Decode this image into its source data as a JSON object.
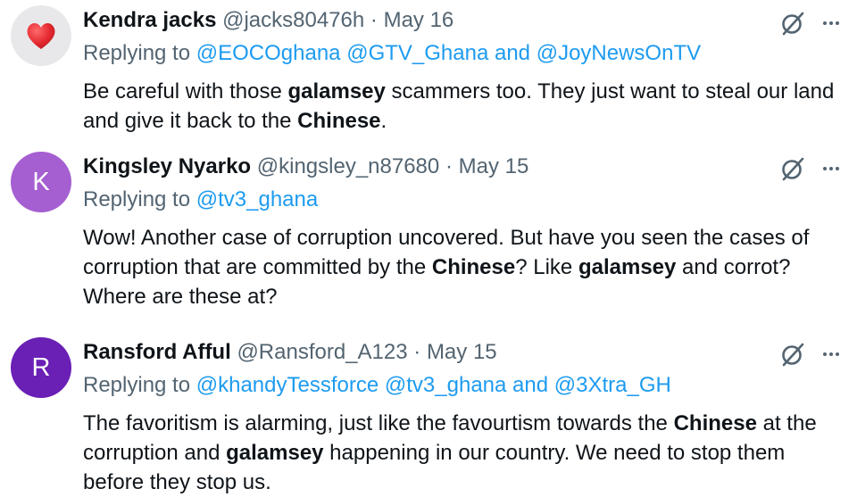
{
  "replies": [
    {
      "avatar": {
        "kind": "heart",
        "icon": "red-heart-icon",
        "color": "#e3282f",
        "bg": "#e8e8ea"
      },
      "name": "Kendra jacks",
      "handle": "@jacks80476h",
      "sep": "·",
      "date": "May 16",
      "replying_to": {
        "label": "Replying to",
        "handles": [
          "@EOCOghana",
          "@GTV_Ghana"
        ],
        "and": "and",
        "last": "@JoyNewsOnTV"
      },
      "text": [
        {
          "t": "Be careful with those "
        },
        {
          "t": "galamsey",
          "b": true
        },
        {
          "t": " scammers too. They just want to steal our land and give it back to the "
        },
        {
          "t": "Chinese",
          "b": true
        },
        {
          "t": "."
        }
      ]
    },
    {
      "avatar": {
        "kind": "letter",
        "letter": "K",
        "bg": "#a55fd1"
      },
      "name": "Kingsley Nyarko",
      "handle": "@kingsley_n87680",
      "sep": "·",
      "date": "May 15",
      "replying_to": {
        "label": "Replying to",
        "handles": [],
        "and": "",
        "last": "@tv3_ghana"
      },
      "text": [
        {
          "t": "Wow! Another case of corruption uncovered. But have you seen the cases of corruption that are committed by the "
        },
        {
          "t": "Chinese",
          "b": true
        },
        {
          "t": "? Like "
        },
        {
          "t": "galamsey",
          "b": true
        },
        {
          "t": " and corrot? Where are these at?"
        }
      ]
    },
    {
      "avatar": {
        "kind": "letter",
        "letter": "R",
        "bg": "#6a1fb5"
      },
      "name": "Ransford Afful",
      "handle": "@Ransford_A123",
      "sep": "·",
      "date": "May 15",
      "replying_to": {
        "label": "Replying to",
        "handles": [
          "@khandyTessforce",
          "@tv3_ghana"
        ],
        "and": "and",
        "last": "@3Xtra_GH"
      },
      "text": [
        {
          "t": "The favoritism is alarming, just like the favourtism towards the "
        },
        {
          "t": "Chinese",
          "b": true
        },
        {
          "t": " at the corruption and "
        },
        {
          "t": "galamsey",
          "b": true
        },
        {
          "t": " happening in our country. We need to stop them before they stop us."
        }
      ]
    }
  ],
  "icons": {
    "grok": "grok-icon",
    "more": "more-options-icon"
  },
  "colors": {
    "text": "#0f1419",
    "secondary": "#536471",
    "link": "#1d9bf0"
  }
}
